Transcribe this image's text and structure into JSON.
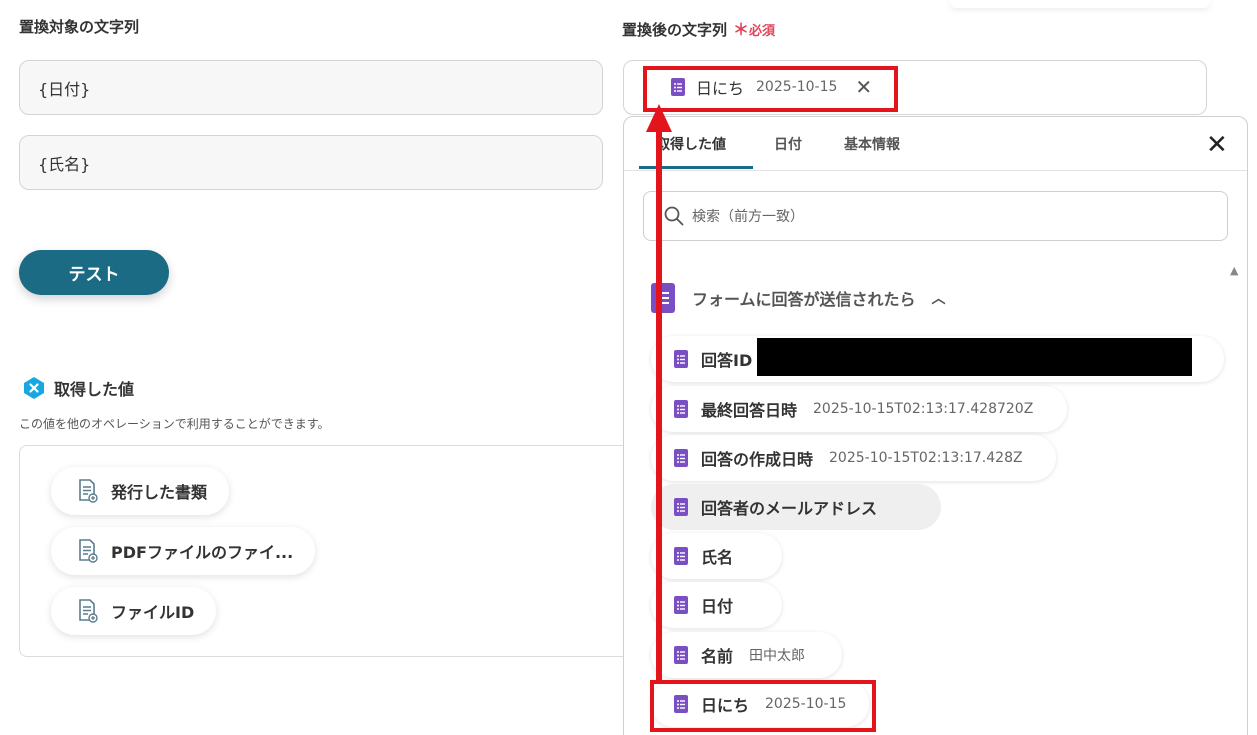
{
  "left": {
    "target_label": "置換対象の文字列",
    "target_fields": [
      "{日付}",
      "{氏名}"
    ],
    "test_button": "テスト",
    "fetched_title": "取得した値",
    "fetched_desc": "この値を他のオペレーションで利用することができます。",
    "outputs": [
      "発行した書類",
      "PDFファイルのファイ...",
      "ファイルID"
    ]
  },
  "right": {
    "replacement_label": "置換後の文字列",
    "required_mark": "＊",
    "required_text": "必須",
    "chip": {
      "label": "日にち",
      "value": "2025-10-15"
    }
  },
  "panel": {
    "tabs": [
      "取得した値",
      "日付",
      "基本情報"
    ],
    "active_tab": 0,
    "search_placeholder": "検索（前方一致）",
    "section_title": "フォームに回答が送信されたら",
    "items": [
      {
        "label": "回答ID",
        "value": ""
      },
      {
        "label": "最終回答日時",
        "value": "2025-10-15T02:13:17.428720Z"
      },
      {
        "label": "回答の作成日時",
        "value": "2025-10-15T02:13:17.428Z"
      },
      {
        "label": "回答者のメールアドレス",
        "value": ""
      },
      {
        "label": "氏名",
        "value": ""
      },
      {
        "label": "日付",
        "value": ""
      },
      {
        "label": "名前",
        "value": "田中太郎"
      },
      {
        "label": "日にち",
        "value": "2025-10-15"
      }
    ]
  },
  "colors": {
    "accent": "#1b6b85",
    "required": "#e0455a",
    "forms_purple": "#7b4fc4",
    "annotation_red": "#e3141b"
  }
}
